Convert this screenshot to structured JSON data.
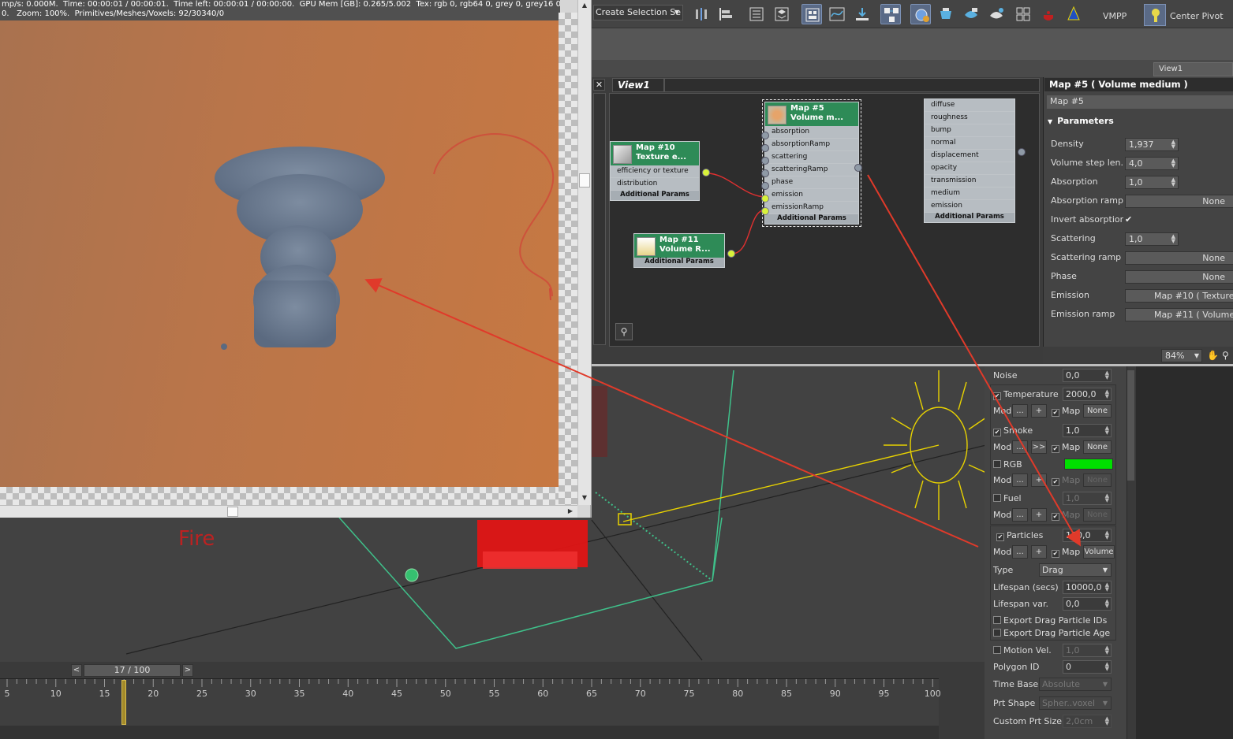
{
  "render_window": {
    "info_line1": "mp/s: 0.000M.  Time: 00:00:01 / 00:00:01.  Time left: 00:00:01 / 00:00:00.  GPU Mem [GB]: 0.265/5.002  Tex: rgb 0, rgb64 0, grey 0, grey16 0.",
    "info_line2": "0.   Zoom: 100%.  Primitives/Meshes/Voxels: 92/30340/0"
  },
  "toolbar": {
    "selection_set_label": "Create Selection Se",
    "vmpp_label": "VMPP",
    "center_pivot_label": "Center Pivot",
    "icons": [
      "mirror-icon",
      "align-icon",
      "list-icon",
      "layers-icon",
      "scene-explorer-icon",
      "curve-editor-icon",
      "dope-sheet-icon",
      "schematic-icon",
      "material-editor-icon",
      "render-setup-icon",
      "render-frame-icon",
      "render-icon",
      "render-production-icon",
      "grid-icon",
      "teapot-icon",
      "light-icon"
    ]
  },
  "slate": {
    "top_tab": "View1",
    "view_tab": "View1",
    "zoom": "84%",
    "nodes": {
      "map10": {
        "title1": "Map #10",
        "title2": "Texture e...",
        "params": [
          "efficiency or texture",
          "distribution"
        ],
        "additional": "Additional Params"
      },
      "map11": {
        "title1": "Map #11",
        "title2": "Volume R...",
        "additional": "Additional Params"
      },
      "map5": {
        "title1": "Map #5",
        "title2": "Volume m...",
        "params": [
          "absorption",
          "absorptionRamp",
          "scattering",
          "scatteringRamp",
          "phase",
          "emission",
          "emissionRamp"
        ],
        "additional": "Additional Params"
      },
      "material": {
        "params": [
          "diffuse",
          "roughness",
          "bump",
          "normal",
          "displacement",
          "opacity",
          "transmission",
          "medium",
          "emission"
        ],
        "additional": "Additional Params"
      }
    }
  },
  "map_panel": {
    "title": "Map #5  ( Volume medium )",
    "name": "Map #5",
    "section": "Parameters",
    "rows": [
      {
        "label": "Density",
        "value": "1,937"
      },
      {
        "label": "Volume step len...",
        "value": "4,0"
      },
      {
        "label": "Absorption",
        "value": "1,0"
      },
      {
        "label": "Absorption ramp",
        "button": "None"
      },
      {
        "label": "Invert absorption",
        "check": "✔"
      },
      {
        "label": "Scattering",
        "value": "1,0"
      },
      {
        "label": "Scattering ramp",
        "button": "None"
      },
      {
        "label": "Phase",
        "button": "None"
      },
      {
        "label": "Emission",
        "button": "Map #10  ( Texture e"
      },
      {
        "label": "Emission ramp",
        "button": "Map #11  ( Volume Ram"
      }
    ]
  },
  "command_panel": {
    "noise_label": "Noise",
    "noise_value": "0,0",
    "temperature_label": "Temperature",
    "temperature_value": "2000,0",
    "smoke_label": "Smoke",
    "smoke_value": "1,0",
    "rgb_label": "RGB",
    "rgb_color": "#00e000",
    "fuel_label": "Fuel",
    "fuel_value": "1,0",
    "particles_label": "Particles",
    "particles_value": "100,0",
    "mod_label": "Mod",
    "dots_label": "...",
    "plus_label": "+",
    "fwd_label": ">>",
    "map_label": "Map",
    "none_label": "None",
    "volume_label": "Volume",
    "type_label": "Type",
    "type_value": "Drag",
    "lifespan_label": "Lifespan (secs)",
    "lifespan_value": "10000,0",
    "lifespan_var_label": "Lifespan var.",
    "lifespan_var_value": "0,0",
    "export_ids_label": "Export Drag Particle IDs",
    "export_age_label": "Export Drag Particle Age",
    "motion_vel_label": "Motion Vel.",
    "motion_vel_value": "1,0",
    "polygon_id_label": "Polygon ID",
    "polygon_id_value": "0",
    "time_base_label": "Time Base",
    "time_base_value": "Absolute",
    "prt_shape_label": "Prt Shape",
    "prt_shape_value": "Spher..voxel",
    "custom_prt_size_label": "Custom Prt Size",
    "custom_prt_size_value": "2,0cm"
  },
  "viewport": {
    "fire_label": "Fire"
  },
  "timeline": {
    "frame_display": "17 / 100",
    "prev": "<",
    "next": ">",
    "current_frame": 17,
    "ticks": [
      "5",
      "10",
      "15",
      "20",
      "25",
      "30",
      "35",
      "40",
      "45",
      "50",
      "55",
      "60",
      "65",
      "70",
      "75",
      "80",
      "85",
      "90",
      "95",
      "100"
    ]
  }
}
